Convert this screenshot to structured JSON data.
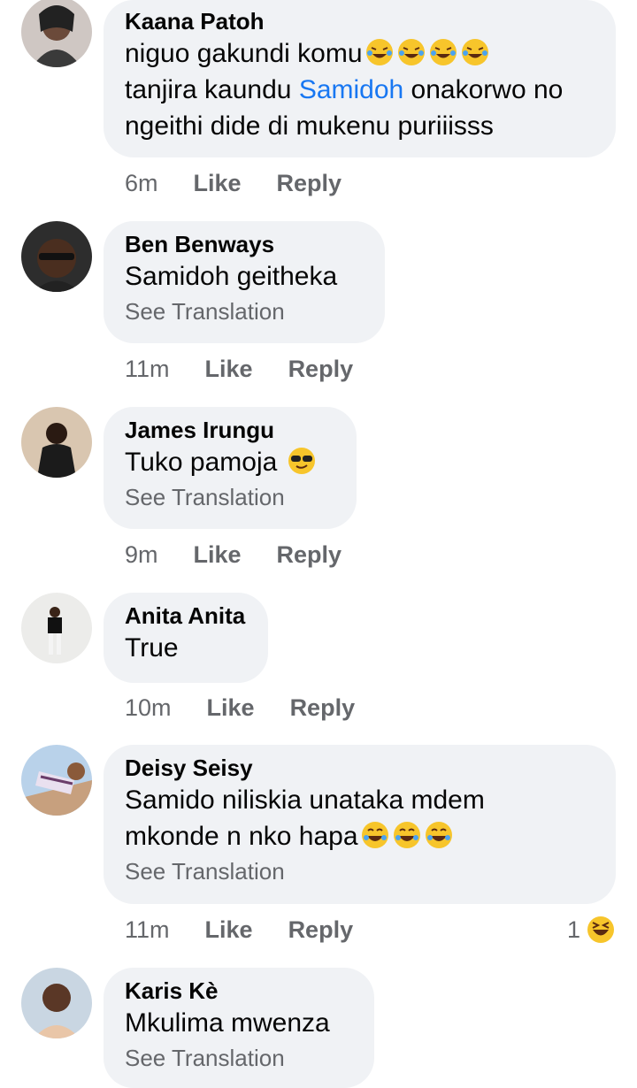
{
  "comments": [
    {
      "author": "Kaana Patoh",
      "text_part1": "niguo gakundi komu",
      "text_part2": "tanjira kaundu ",
      "mention": "Samidoh",
      "text_part3": " onakorwo no",
      "text_part4": "ngeithi dide di mukenu puriiisss",
      "time": "6m",
      "like": "Like",
      "reply": "Reply"
    },
    {
      "author": "Ben Benways",
      "text": "Samidoh geitheka",
      "see_translation": "See Translation",
      "time": "11m",
      "like": "Like",
      "reply": "Reply"
    },
    {
      "author": "James Irungu",
      "text": "Tuko pamoja ",
      "see_translation": "See Translation",
      "time": "9m",
      "like": "Like",
      "reply": "Reply"
    },
    {
      "author": "Anita Anita",
      "text": "True",
      "time": "10m",
      "like": "Like",
      "reply": "Reply"
    },
    {
      "author": "Deisy Seisy",
      "text_line1": "Samido niliskia unataka mdem",
      "text_line2": "mkonde n nko hapa",
      "see_translation": "See Translation",
      "time": "11m",
      "like": "Like",
      "reply": "Reply",
      "reaction_count": "1"
    },
    {
      "author": "Karis Kè",
      "text": "Mkulima mwenza",
      "see_translation": "See Translation"
    }
  ],
  "colors": {
    "bubble": "#f0f2f5",
    "mention": "#1877f2",
    "secondary_text": "#65676b"
  }
}
